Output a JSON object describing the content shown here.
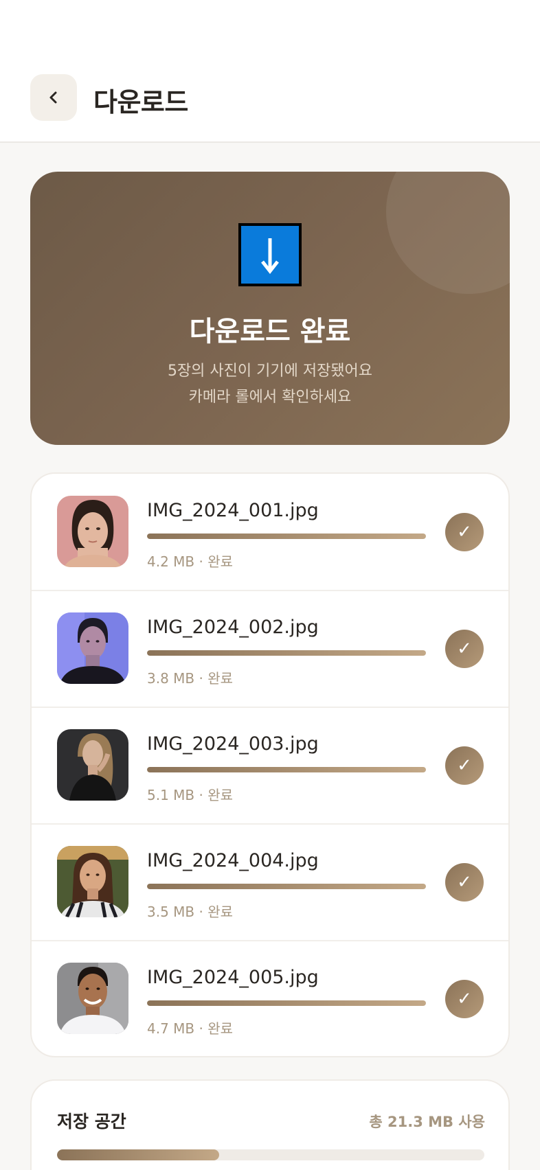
{
  "header": {
    "title": "다운로드",
    "back_icon": "chevron-left-icon"
  },
  "hero": {
    "icon": "download-arrow-icon",
    "title": "다운로드 완료",
    "subtitle_line1": "5장의 사진이 기기에 저장됐어요",
    "subtitle_line2": "카메라 롤에서 확인하세요"
  },
  "downloads": [
    {
      "name": "IMG_2024_001.jpg",
      "meta": "4.2 MB · 완료",
      "progress": 1.0,
      "check": "✓"
    },
    {
      "name": "IMG_2024_002.jpg",
      "meta": "3.8 MB · 완료",
      "progress": 1.0,
      "check": "✓"
    },
    {
      "name": "IMG_2024_003.jpg",
      "meta": "5.1 MB · 완료",
      "progress": 1.0,
      "check": "✓"
    },
    {
      "name": "IMG_2024_004.jpg",
      "meta": "3.5 MB · 완료",
      "progress": 1.0,
      "check": "✓"
    },
    {
      "name": "IMG_2024_005.jpg",
      "meta": "4.7 MB · 완료",
      "progress": 1.0,
      "check": "✓"
    }
  ],
  "storage": {
    "title": "저장 공간",
    "total": "총 21.3 MB 사용",
    "used_fraction": 0.38
  },
  "colors": {
    "accent": "#8b7358",
    "accent_light": "#c3a887",
    "hero_start": "#6d5a47",
    "hero_end": "#8b7358",
    "icon_blue": "#0a7bdb"
  }
}
